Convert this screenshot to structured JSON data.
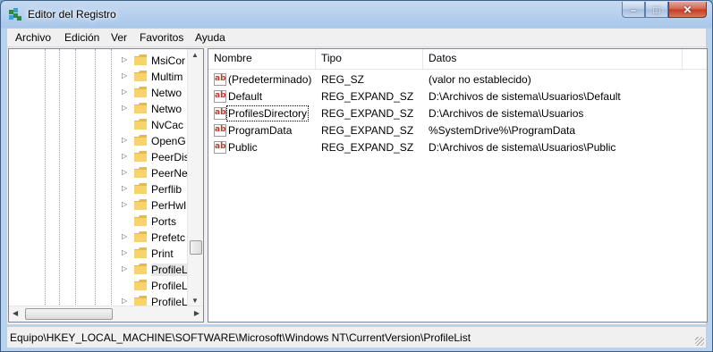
{
  "window": {
    "title": "Editor del Registro"
  },
  "caption": {
    "minimize": "–",
    "maximize": "□",
    "close": "✕"
  },
  "menu": [
    "Archivo",
    "Edición",
    "Ver",
    "Favoritos",
    "Ayuda"
  ],
  "tree": {
    "items": [
      {
        "label": "MsiCor",
        "expandable": true
      },
      {
        "label": "Multim",
        "expandable": true
      },
      {
        "label": "Netwo",
        "expandable": true
      },
      {
        "label": "Netwo",
        "expandable": true
      },
      {
        "label": "NvCac",
        "expandable": false
      },
      {
        "label": "OpenG",
        "expandable": true
      },
      {
        "label": "PeerDis",
        "expandable": true
      },
      {
        "label": "PeerNe",
        "expandable": true
      },
      {
        "label": "Perflib",
        "expandable": true
      },
      {
        "label": "PerHwI",
        "expandable": true
      },
      {
        "label": "Ports",
        "expandable": false
      },
      {
        "label": "Prefetc",
        "expandable": true
      },
      {
        "label": "Print",
        "expandable": true
      },
      {
        "label": "ProfileL",
        "expandable": true,
        "selected": true
      },
      {
        "label": "ProfileL",
        "expandable": false
      },
      {
        "label": "ProfileL",
        "expandable": true
      }
    ]
  },
  "list": {
    "columns": [
      "Nombre",
      "Tipo",
      "Datos"
    ],
    "rows": [
      {
        "name": "(Predeterminado)",
        "type": "REG_SZ",
        "data": "(valor no establecido)"
      },
      {
        "name": "Default",
        "type": "REG_EXPAND_SZ",
        "data": "D:\\Archivos de sistema\\Usuarios\\Default"
      },
      {
        "name": "ProfilesDirectory",
        "type": "REG_EXPAND_SZ",
        "data": "D:\\Archivos de sistema\\Usuarios"
      },
      {
        "name": "ProgramData",
        "type": "REG_EXPAND_SZ",
        "data": "%SystemDrive%\\ProgramData"
      },
      {
        "name": "Public",
        "type": "REG_EXPAND_SZ",
        "data": "D:\\Archivos de sistema\\Usuarios\\Public"
      }
    ],
    "value_icon": "ab"
  },
  "status": {
    "path": "Equipo\\HKEY_LOCAL_MACHINE\\SOFTWARE\\Microsoft\\Windows NT\\CurrentVersion\\ProfileList"
  }
}
